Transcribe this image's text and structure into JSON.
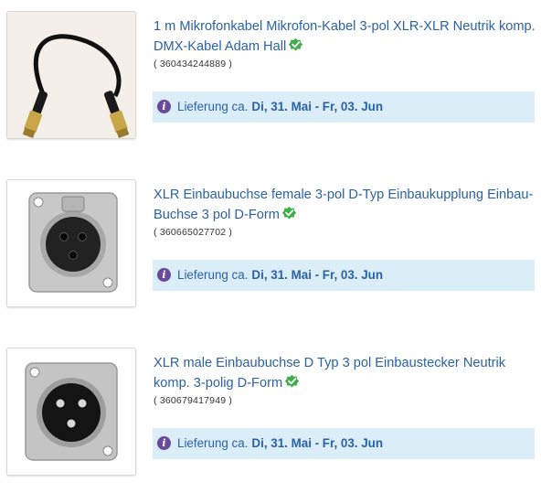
{
  "colors": {
    "link": "#2a62a8",
    "verified_badge": "#3fae49",
    "delivery_bg": "#dbedf7",
    "info_icon": "#6b4a9c"
  },
  "items": [
    {
      "title": "1 m Mikrofonkabel Mikrofon-Kabel 3-pol XLR-XLR Neutrik komp. DMX-Kabel Adam Hall",
      "item_number": "( 360434244889 )",
      "delivery_label": "Lieferung ca.",
      "delivery_dates": "Di, 31. Mai - Fr, 03. Jun",
      "image_icon": "xlr-cable-image",
      "badge_icon": "verified-check-icon"
    },
    {
      "title": "XLR Einbaubuchse female 3-pol D-Typ Einbaukupplung Einbau-Buchse 3 pol D-Form",
      "item_number": "( 360665027702 )",
      "delivery_label": "Lieferung ca.",
      "delivery_dates": "Di, 31. Mai - Fr, 03. Jun",
      "image_icon": "xlr-female-panel-jack-image",
      "badge_icon": "verified-check-icon"
    },
    {
      "title": "XLR male Einbaubuchse D Typ 3 pol Einbaustecker Neutrik komp. 3-polig D-Form",
      "item_number": "( 360679417949 )",
      "delivery_label": "Lieferung ca.",
      "delivery_dates": "Di, 31. Mai - Fr, 03. Jun",
      "image_icon": "xlr-male-panel-jack-image",
      "badge_icon": "verified-check-icon"
    }
  ]
}
